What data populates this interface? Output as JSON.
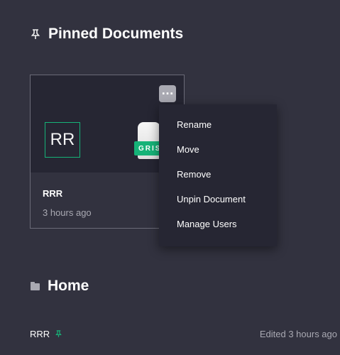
{
  "pinned_section": {
    "title": "Pinned Documents",
    "icon": "pin-icon"
  },
  "card": {
    "initials": "RR",
    "logo_text": "GRIS",
    "menu_button_label": "…",
    "name": "RRR",
    "edited": "3 hours ago"
  },
  "context_menu": {
    "items": [
      "Rename",
      "Move",
      "Remove",
      "Unpin Document",
      "Manage Users"
    ]
  },
  "home_section": {
    "title": "Home",
    "icon": "folder-icon",
    "documents": [
      {
        "name": "RRR",
        "pinned_icon": "pin-icon",
        "edited": "Edited 3 hours ago"
      }
    ]
  },
  "colors": {
    "background": "#32323f",
    "panel": "#262633",
    "accent": "#16b378",
    "muted_text": "#a9a9b2"
  }
}
